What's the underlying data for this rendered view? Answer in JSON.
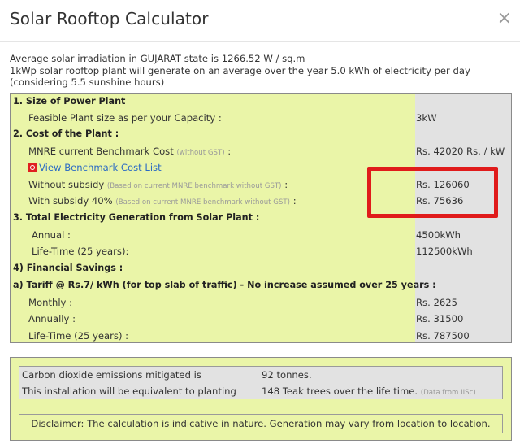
{
  "dialog": {
    "title": "Solar Rooftop Calculator",
    "close_label": "×"
  },
  "intro": {
    "line1": "Average solar irradiation in GUJARAT state is 1266.52 W / sq.m",
    "line2": "1kWp solar rooftop plant will generate on an average over the year 5.0 kWh of electricity per day (considering 5.5 sunshine hours)"
  },
  "calc": {
    "size_heading": "1. Size of Power Plant",
    "feasible_label": "Feasible Plant size as per your Capacity :",
    "feasible_value": "3kW",
    "cost_heading": "2. Cost of the Plant :",
    "benchmark_label": "MNRE current Benchmark Cost",
    "benchmark_note": "(without GST)",
    "benchmark_colon": ":",
    "benchmark_value": "Rs. 42020 Rs. / kW",
    "benchmark_link": "View Benchmark Cost List",
    "without_subsidy_label": "Without subsidy",
    "without_subsidy_note": "(Based on current MNRE benchmark without GST)",
    "without_subsidy_colon": ":",
    "without_subsidy_value": "Rs. 126060",
    "with_subsidy_label": "With subsidy 40%",
    "with_subsidy_note": "(Based on current MNRE benchmark without GST)",
    "with_subsidy_colon": ":",
    "with_subsidy_value": "Rs. 75636",
    "generation_heading": "3. Total Electricity Generation from Solar Plant :",
    "annual_label": "Annual :",
    "annual_value": "4500kWh",
    "lifetime_gen_label": "Life-Time (25 years):",
    "lifetime_gen_value": "112500kWh",
    "savings_heading": "4) Financial Savings :",
    "tariff_heading": "a) Tariff @ Rs.7/ kWh (for top slab of traffic) - No increase assumed over 25 years :",
    "monthly_label": "Monthly :",
    "monthly_value": "Rs. 2625",
    "annually_label": "Annually :",
    "annually_value": "Rs. 31500",
    "lifetime_savings_label": "Life-Time (25 years) :",
    "lifetime_savings_value": "Rs. 787500"
  },
  "environment": {
    "co2_label": "Carbon dioxide emissions mitigated is",
    "co2_value": "92 tonnes.",
    "trees_label": "This installation will be equivalent to planting",
    "trees_value": "148 Teak trees over the life time.",
    "trees_note": "(Data from IISc)",
    "disclaimer": "Disclaimer: The calculation is indicative in nature. Generation may vary from location to location."
  },
  "colors": {
    "panel_green": "#eaf5a8",
    "value_gray": "#e2e2e2",
    "highlight_red": "#e01b1b",
    "link_blue": "#2a6ac4"
  }
}
